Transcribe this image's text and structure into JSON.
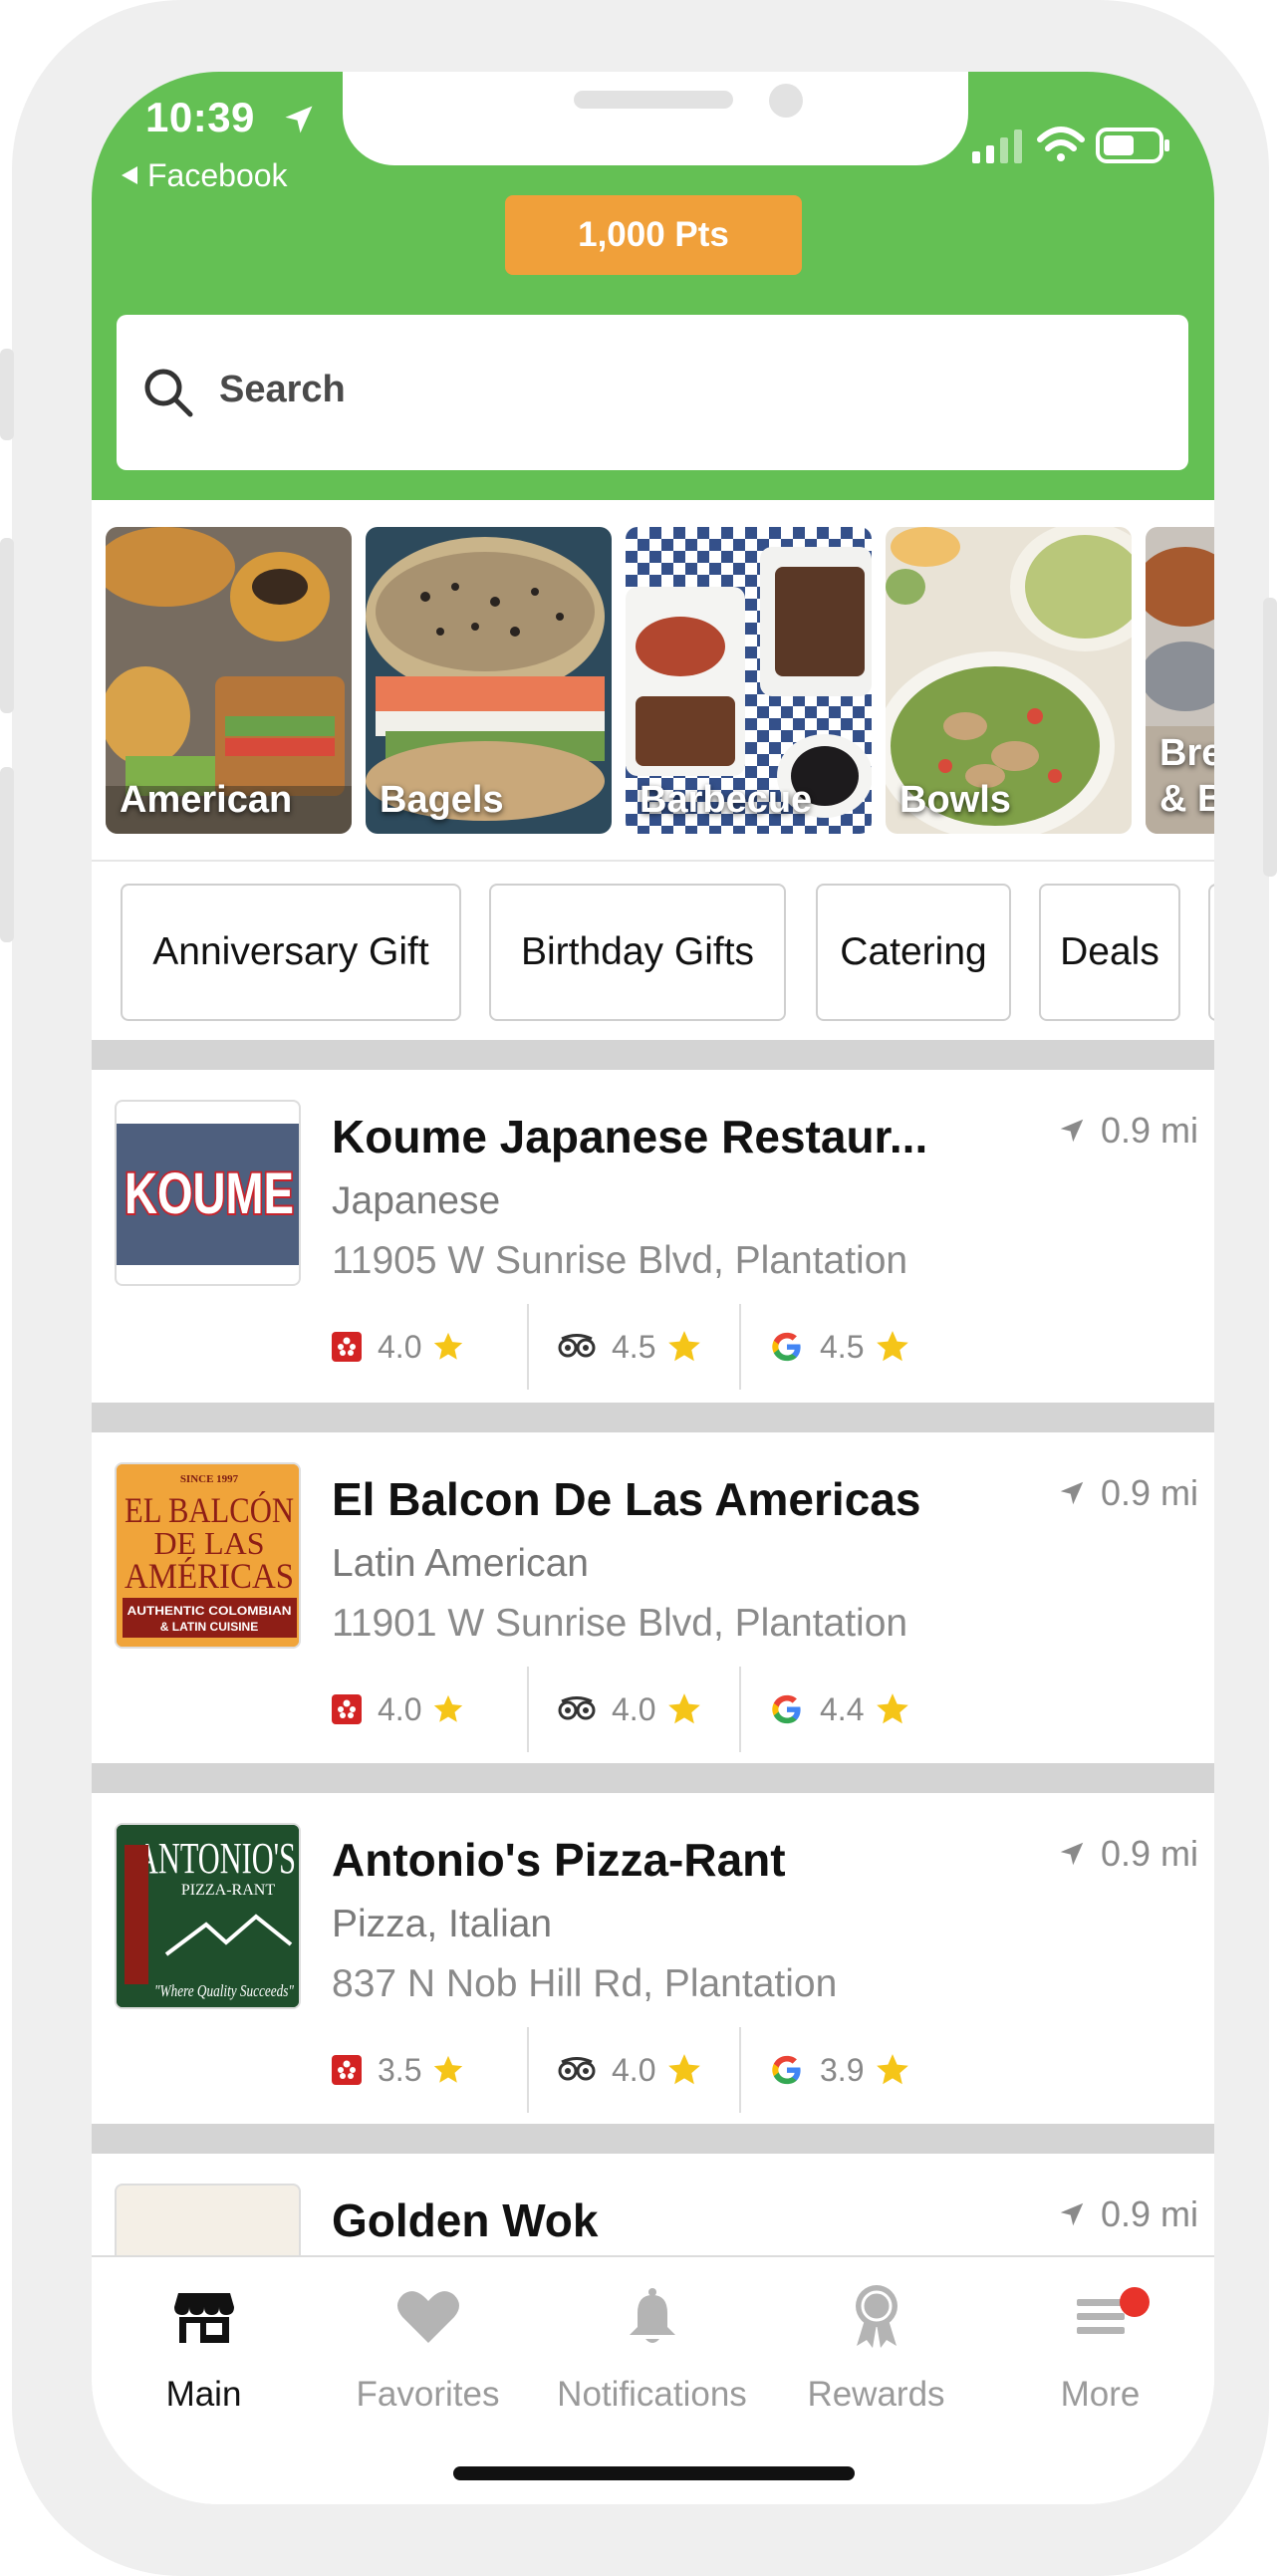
{
  "status_bar": {
    "time": "10:39",
    "back_app": "Facebook"
  },
  "header": {
    "points": "1,000 Pts",
    "search_placeholder": "Search"
  },
  "categories": [
    {
      "label": "American"
    },
    {
      "label": "Bagels"
    },
    {
      "label": "Barbecue"
    },
    {
      "label": "Bowls"
    },
    {
      "label": "Bre",
      "label2": "& B"
    }
  ],
  "tags": [
    {
      "label": "Anniversary Gift"
    },
    {
      "label": "Birthday Gifts"
    },
    {
      "label": "Catering"
    },
    {
      "label": "Deals"
    }
  ],
  "restaurants": [
    {
      "name": "Koume Japanese Restaur...",
      "cuisine": "Japanese",
      "address": "11905 W Sunrise Blvd, Plantation",
      "distance": "0.9 mi",
      "logo_text": "KOUME",
      "ratings": {
        "yelp": "4.0",
        "tripadvisor": "4.5",
        "google": "4.5"
      }
    },
    {
      "name": "El Balcon De Las Americas",
      "cuisine": "Latin American",
      "address": "11901 W Sunrise Blvd, Plantation",
      "distance": "0.9 mi",
      "logo_text": "SINCE 1997",
      "logo_line1": "EL BALCÓN",
      "logo_line2": "DE LAS",
      "logo_line3": "AMÉRICAS",
      "logo_banner": "AUTHENTIC COLOMBIAN & LATIN CUISINE",
      "ratings": {
        "yelp": "4.0",
        "tripadvisor": "4.0",
        "google": "4.4"
      }
    },
    {
      "name": "Antonio's Pizza-Rant",
      "cuisine": "Pizza, Italian",
      "address": "837 N Nob Hill Rd, Plantation",
      "distance": "0.9 mi",
      "logo_text": "ANTONIO'S",
      "logo_sub": "PIZZA-RANT",
      "logo_tagline": "\"Where Quality Succeeds\"",
      "ratings": {
        "yelp": "3.5",
        "tripadvisor": "4.0",
        "google": "3.9"
      }
    },
    {
      "name": "Golden Wok",
      "distance": "0.9 mi"
    }
  ],
  "tabbar": [
    {
      "label": "Main",
      "icon": "store-icon",
      "active": true
    },
    {
      "label": "Favorites",
      "icon": "heart-icon"
    },
    {
      "label": "Notifications",
      "icon": "bell-icon"
    },
    {
      "label": "Rewards",
      "icon": "award-ribbon-icon"
    },
    {
      "label": "More",
      "icon": "menu-lines-icon",
      "badge": true
    }
  ],
  "colors": {
    "header_green": "#64c054",
    "points_orange": "#f0a03a",
    "star_yellow": "#f5c518",
    "yelp_red": "#d32323",
    "badge_red": "#e8332a"
  }
}
